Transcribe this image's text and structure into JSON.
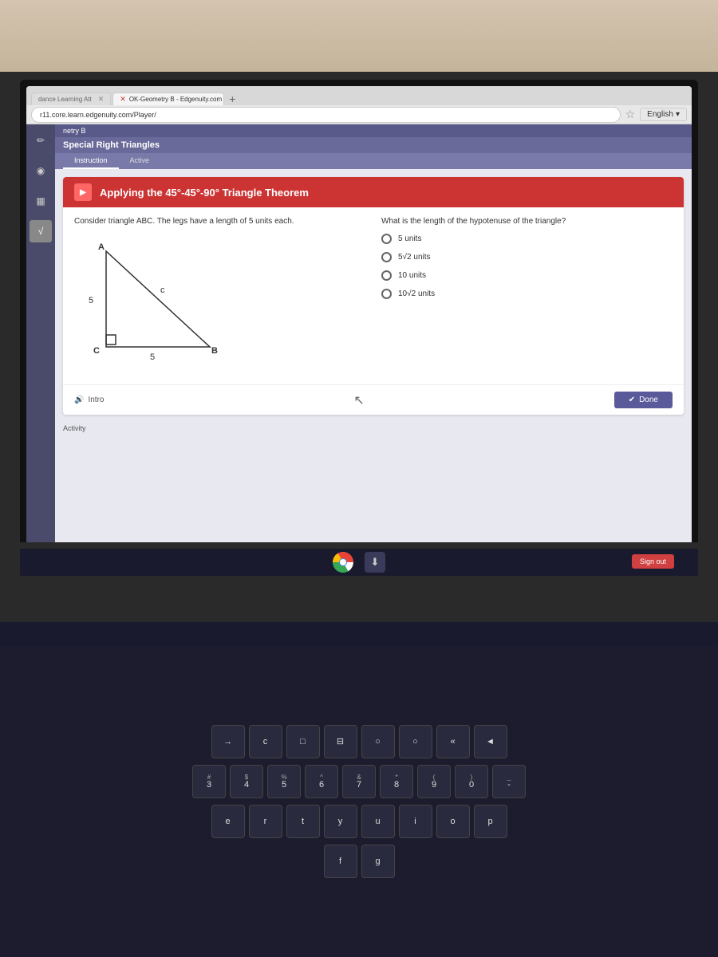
{
  "room": {
    "bg_color": "#d4c4b0"
  },
  "browser": {
    "tabs": [
      {
        "label": "dance Learning Att",
        "active": false,
        "closeable": true
      },
      {
        "label": "OK-Geometry B - Edgenuity.com",
        "active": true,
        "closeable": true
      }
    ],
    "new_tab_icon": "+",
    "address": "r11.core.learn.edgenuity.com/Player/",
    "english_label": "English",
    "bookmark_icon": "☆"
  },
  "sidebar": {
    "icons": [
      {
        "name": "edit",
        "symbol": "✏",
        "active": false
      },
      {
        "name": "audio",
        "symbol": "🎧",
        "active": false
      },
      {
        "name": "grid",
        "symbol": "⊞",
        "active": false
      },
      {
        "name": "math",
        "symbol": "√",
        "active": false
      }
    ]
  },
  "page": {
    "subject": "netry B",
    "section_title": "Special Right Triangles",
    "tabs": [
      {
        "label": "Instruction",
        "active": true
      },
      {
        "label": "Active",
        "active": false
      }
    ],
    "card": {
      "header_icon": "▶",
      "title": "Applying the 45°-45°-90° Triangle Theorem",
      "problem_text": "Consider triangle ABC. The legs have a length of 5 units each.",
      "question": "What is the length of the hypotenuse of the triangle?",
      "answers": [
        {
          "label": "5 units",
          "selected": false
        },
        {
          "label": "5√2 units",
          "selected": false,
          "has_sqrt": true,
          "sqrt_val": "2"
        },
        {
          "label": "10 units",
          "selected": false
        },
        {
          "label": "10√2 units",
          "selected": false,
          "has_sqrt": true,
          "sqrt_val": "2"
        }
      ],
      "triangle": {
        "vertices": {
          "A": "top-left",
          "B": "bottom-right",
          "C": "bottom-left"
        },
        "labels": {
          "AC": "5",
          "CB": "5",
          "AB": "c"
        },
        "right_angle": "C"
      },
      "intro_label": "Intro",
      "done_label": "Done"
    }
  },
  "taskbar": {
    "sign_out_label": "Sign out",
    "activity_label": "Activity"
  },
  "keyboard": {
    "rows": [
      [
        "→",
        "c",
        "□",
        "⊟",
        "○",
        "○",
        "«",
        "◄"
      ],
      [
        "#3",
        "$4",
        "%5",
        "^6",
        "&7",
        "*8",
        "(9",
        ")0",
        "-"
      ],
      [
        "e",
        "r",
        "t",
        "y",
        "u",
        "i",
        "o",
        "p"
      ],
      [
        "f",
        "g"
      ]
    ]
  }
}
